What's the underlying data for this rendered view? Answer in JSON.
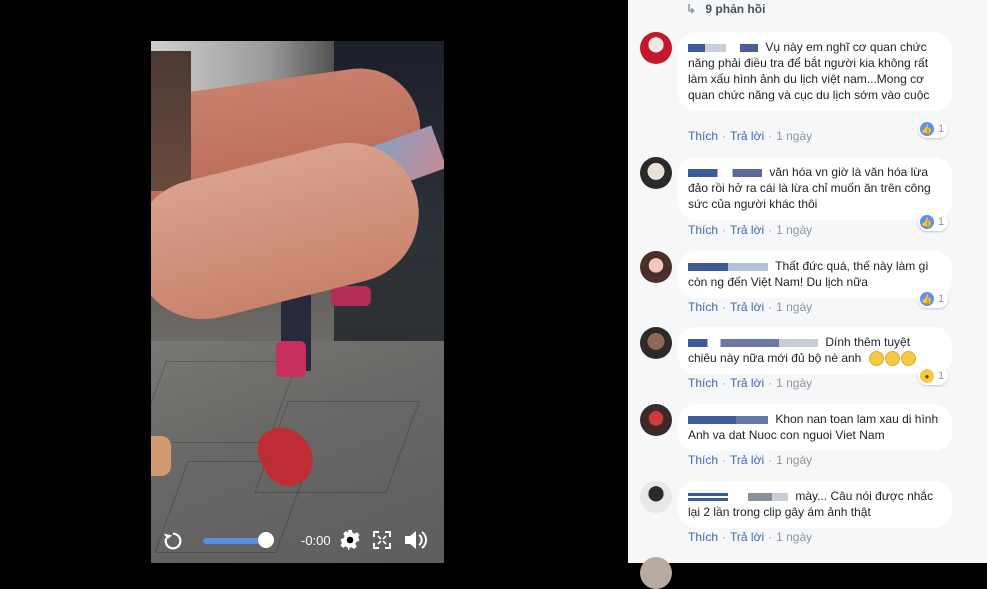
{
  "video": {
    "time": "-0:00",
    "progress_fraction": 0.95,
    "icons": [
      "replay-icon",
      "gear-icon",
      "fullscreen-icon",
      "volume-icon"
    ]
  },
  "comments_panel": {
    "replies_link": "9 phản hồi",
    "items": [
      {
        "text": "Vụ này em nghĩ cơ quan chức năng phải điều tra để bắt người kia không rất làm xấu hình ảnh du lịch việt nam...Mong cơ quan chức năng và cục du lịch sớm vào cuộc",
        "like": "Thích",
        "reply": "Trả lời",
        "time": "1 ngày",
        "reaction_count": "1",
        "reaction": "like"
      },
      {
        "text": "văn hóa vn giờ là văn hóa lừa đảo rồi hở ra cái là lừa chỉ muốn ăn trên công sức của người khác thôi",
        "like": "Thích",
        "reply": "Trả lời",
        "time": "1 ngày",
        "reaction_count": "1",
        "reaction": "like"
      },
      {
        "text": "Thất đức quá, thế này làm gì còn ng đến Việt Nam! Du lịch nữa",
        "like": "Thích",
        "reply": "Trả lời",
        "time": "1 ngày",
        "reaction_count": "1",
        "reaction": "like"
      },
      {
        "text": "Dính thêm tuyệt chiêu này nữa mới đủ bộ nè anh",
        "like": "Thích",
        "reply": "Trả lời",
        "time": "1 ngày",
        "reaction_count": "1",
        "reaction": "wow"
      },
      {
        "text": "Khon nan toan lam xau di hình Anh va dat Nuoc con nguoi Viet Nam",
        "like": "Thích",
        "reply": "Trả lời",
        "time": "1 ngày"
      },
      {
        "text": "mày... Câu nói được nhắc lại 2 lần trong clip gây ám ảnh thật",
        "like": "Thích",
        "reply": "Trả lời",
        "time": "1 ngày"
      }
    ]
  },
  "colors": {
    "link": "#4267b2",
    "like_blue": "#5890ff",
    "bubble": "#ffffff",
    "panel_bg": "#f6f7f9"
  }
}
